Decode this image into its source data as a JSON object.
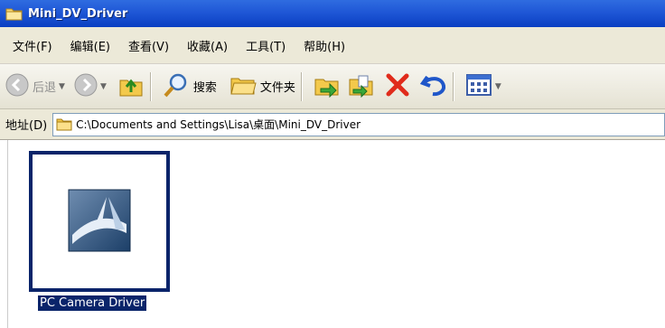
{
  "window": {
    "title": "Mini_DV_Driver"
  },
  "menu": [
    "文件(F)",
    "编辑(E)",
    "查看(V)",
    "收藏(A)",
    "工具(T)",
    "帮助(H)"
  ],
  "toolbar": {
    "back_label": "后退",
    "search_label": "搜索",
    "folders_label": "文件夹"
  },
  "address": {
    "label": "地址(D)",
    "path": "C:\\Documents and Settings\\Lisa\\桌面\\Mini_DV_Driver"
  },
  "files": [
    {
      "name": "PC Camera Driver",
      "icon": "installer-icon",
      "selected": true
    }
  ],
  "colors": {
    "titlebar": "#1f57d6",
    "selection": "#0a246a",
    "chrome": "#ece9d8"
  }
}
